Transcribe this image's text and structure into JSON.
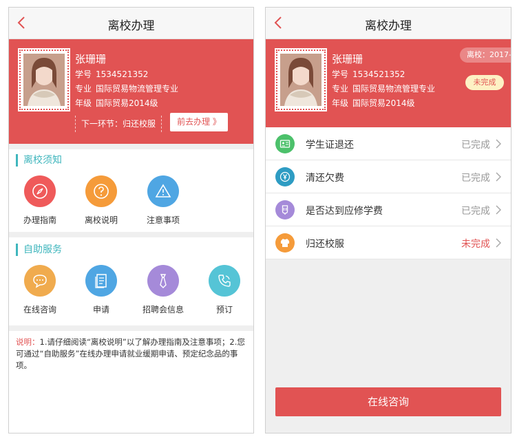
{
  "left": {
    "nav_title": "离校办理",
    "student": {
      "name": "张珊珊",
      "id_label": "学号",
      "id_value": "1534521352",
      "major_label": "专业",
      "major_value": "国际贸易物流管理专业",
      "grade_label": "年级",
      "grade_value": "国际贸易2014级"
    },
    "next_step_text": "下一环节：归还校服",
    "go_button": "前去办理 》",
    "notice_section": {
      "title": "离校须知",
      "items": [
        {
          "label": "办理指南",
          "icon": "compass-icon",
          "color": "#ef5a5a"
        },
        {
          "label": "离校说明",
          "icon": "question-icon",
          "color": "#f59b3a"
        },
        {
          "label": "注意事项",
          "icon": "warning-icon",
          "color": "#4fa6e3"
        }
      ]
    },
    "service_section": {
      "title": "自助服务",
      "items": [
        {
          "label": "在线咨询",
          "icon": "chat-icon",
          "color": "#f0ab4e"
        },
        {
          "label": "申请",
          "icon": "document-icon",
          "color": "#4fa6e3"
        },
        {
          "label": "招聘会信息",
          "icon": "tie-icon",
          "color": "#a58ad9"
        },
        {
          "label": "预订",
          "icon": "phone-icon",
          "color": "#55c4d6"
        }
      ]
    },
    "note": {
      "prefix": "说明：",
      "text": "1.请仔细阅读“离校说明”以了解办理指南及注意事项；2.您可通过“自助服务”在线办理申请就业缓期申请、预定纪念品的事项。"
    }
  },
  "right": {
    "nav_title": "离校办理",
    "student": {
      "name": "张珊珊",
      "id_label": "学号",
      "id_value": "1534521352",
      "major_label": "专业",
      "major_value": "国际贸易物流管理专业",
      "grade_label": "年级",
      "grade_value": "国际贸易2014级"
    },
    "leave_time_tag": "离校：2017-",
    "status_tag": "未完成",
    "tasks": [
      {
        "label": "学生证退还",
        "status": "已完成",
        "icon": "id-card-icon",
        "color": "#4cc16b"
      },
      {
        "label": "清还欠费",
        "status": "已完成",
        "icon": "yen-icon",
        "color": "#2e9cc3"
      },
      {
        "label": "是否达到应修学费",
        "status": "已完成",
        "icon": "bookmark-icon",
        "color": "#a58ad9"
      },
      {
        "label": "归还校服",
        "status": "未完成",
        "icon": "shirt-icon",
        "color": "#f59b3a"
      }
    ],
    "consult_button": "在线咨询"
  },
  "colors": {
    "primary_red": "#e15353",
    "accent_teal": "#3fb6bd",
    "pending_red": "#e15353",
    "done_gray": "#999999"
  }
}
